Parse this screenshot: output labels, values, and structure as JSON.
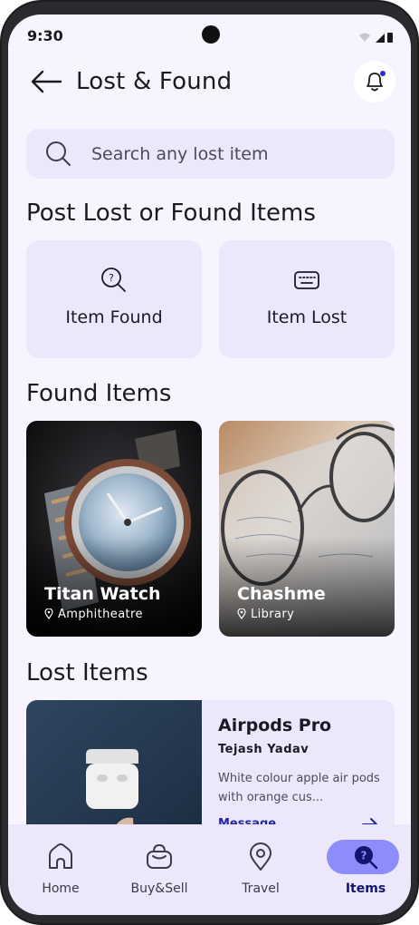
{
  "status_bar": {
    "time": "9:30"
  },
  "header": {
    "title": "Lost & Found"
  },
  "search": {
    "placeholder": "Search any lost item"
  },
  "post_section": {
    "title": "Post Lost or Found Items",
    "actions": [
      {
        "label": "Item Found",
        "icon": "question-search-icon"
      },
      {
        "label": "Item Lost",
        "icon": "keyboard-icon"
      }
    ]
  },
  "found_section": {
    "title": "Found Items",
    "items": [
      {
        "name": "Titan Watch",
        "location": "Amphitheatre",
        "image": "wristwatch-photo"
      },
      {
        "name": "Chashme",
        "location": "Library",
        "image": "eyeglasses-photo"
      }
    ]
  },
  "lost_section": {
    "title": "Lost Items",
    "items": [
      {
        "name": "Airpods Pro",
        "owner": "Tejash Yadav",
        "description": "White colour apple air pods with orange cus...",
        "action": "Message",
        "image": "airpods-photo"
      }
    ]
  },
  "bottom_nav": {
    "items": [
      {
        "label": "Home",
        "icon": "home-icon"
      },
      {
        "label": "Buy&Sell",
        "icon": "shopping-bag-icon"
      },
      {
        "label": "Travel",
        "icon": "location-pin-icon"
      },
      {
        "label": "Items",
        "icon": "question-search-icon",
        "active": true
      }
    ]
  },
  "colors": {
    "background": "#f8f4ff",
    "card": "#ece7fa",
    "active_pill": "#8c8cfb",
    "link": "#2424a8"
  }
}
